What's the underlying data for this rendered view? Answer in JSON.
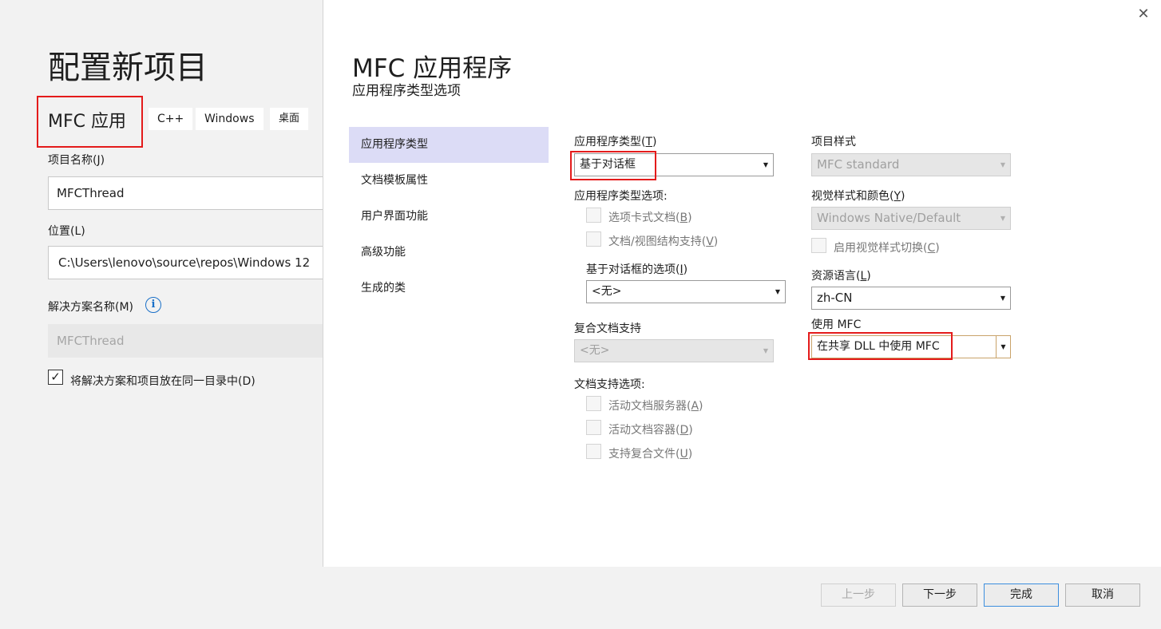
{
  "left": {
    "title": "配置新项目",
    "project_type": "MFC 应用",
    "tags": [
      "C++",
      "Windows",
      "桌面"
    ],
    "project_name_label": "项目名称(J)",
    "project_name_value": "MFCThread",
    "location_label": "位置(L)",
    "location_value": "C:\\Users\\lenovo\\source\\repos\\Windows 12",
    "solution_name_label": "解决方案名称(M)",
    "solution_name_value": "MFCThread",
    "same_dir_label": "将解决方案和项目放在同一目录中(D)",
    "same_dir_checked": true,
    "checkmark": "✓",
    "info_icon": "i"
  },
  "wizard": {
    "title": "MFC 应用程序",
    "subtitle": "应用程序类型选项",
    "close_glyph": "✕",
    "nav": [
      "应用程序类型",
      "文档模板属性",
      "用户界面功能",
      "高级功能",
      "生成的类"
    ],
    "selected_nav": 0
  },
  "options": {
    "app_type_label": "应用程序类型(",
    "app_type_key": "T",
    "app_type_value": "基于对话框",
    "app_type_options_label": "应用程序类型选项:",
    "tabbed_docs_label": "选项卡式文档(",
    "tabbed_docs_key": "B",
    "docview_label": "文档/视图结构支持(",
    "docview_key": "V",
    "dialog_options_label": "基于对话框的选项(",
    "dialog_options_key": "I",
    "dialog_options_value": "<无>",
    "compound_doc_label": "复合文档支持",
    "compound_doc_value": "<无>",
    "doc_support_label": "文档支持选项:",
    "active_server_label": "活动文档服务器(",
    "active_server_key": "A",
    "active_container_label": "活动文档容器(",
    "active_container_key": "D",
    "compound_files_label": "支持复合文件(",
    "compound_files_key": "U",
    "close_paren": ")",
    "project_style_label": "项目样式",
    "project_style_value": "MFC standard",
    "visual_style_label": "视觉样式和颜色(",
    "visual_style_key": "Y",
    "visual_style_value": "Windows Native/Default",
    "enable_visual_switch_label": "启用视觉样式切换(",
    "enable_visual_switch_key": "C",
    "resource_lang_label": "资源语言(",
    "resource_lang_key": "L",
    "resource_lang_value": "zh-CN",
    "use_mfc_label": "使用 MFC",
    "use_mfc_value": "在共享 DLL 中使用 MFC",
    "dropdown_glyph": "▼"
  },
  "footer": {
    "prev": "上一步",
    "next": "下一步",
    "finish": "完成",
    "cancel": "取消"
  },
  "colors": {
    "highlight_red": "#e41b1b",
    "selected_nav_bg": "#dcdcf6",
    "primary_button_border": "#3c8ede"
  }
}
